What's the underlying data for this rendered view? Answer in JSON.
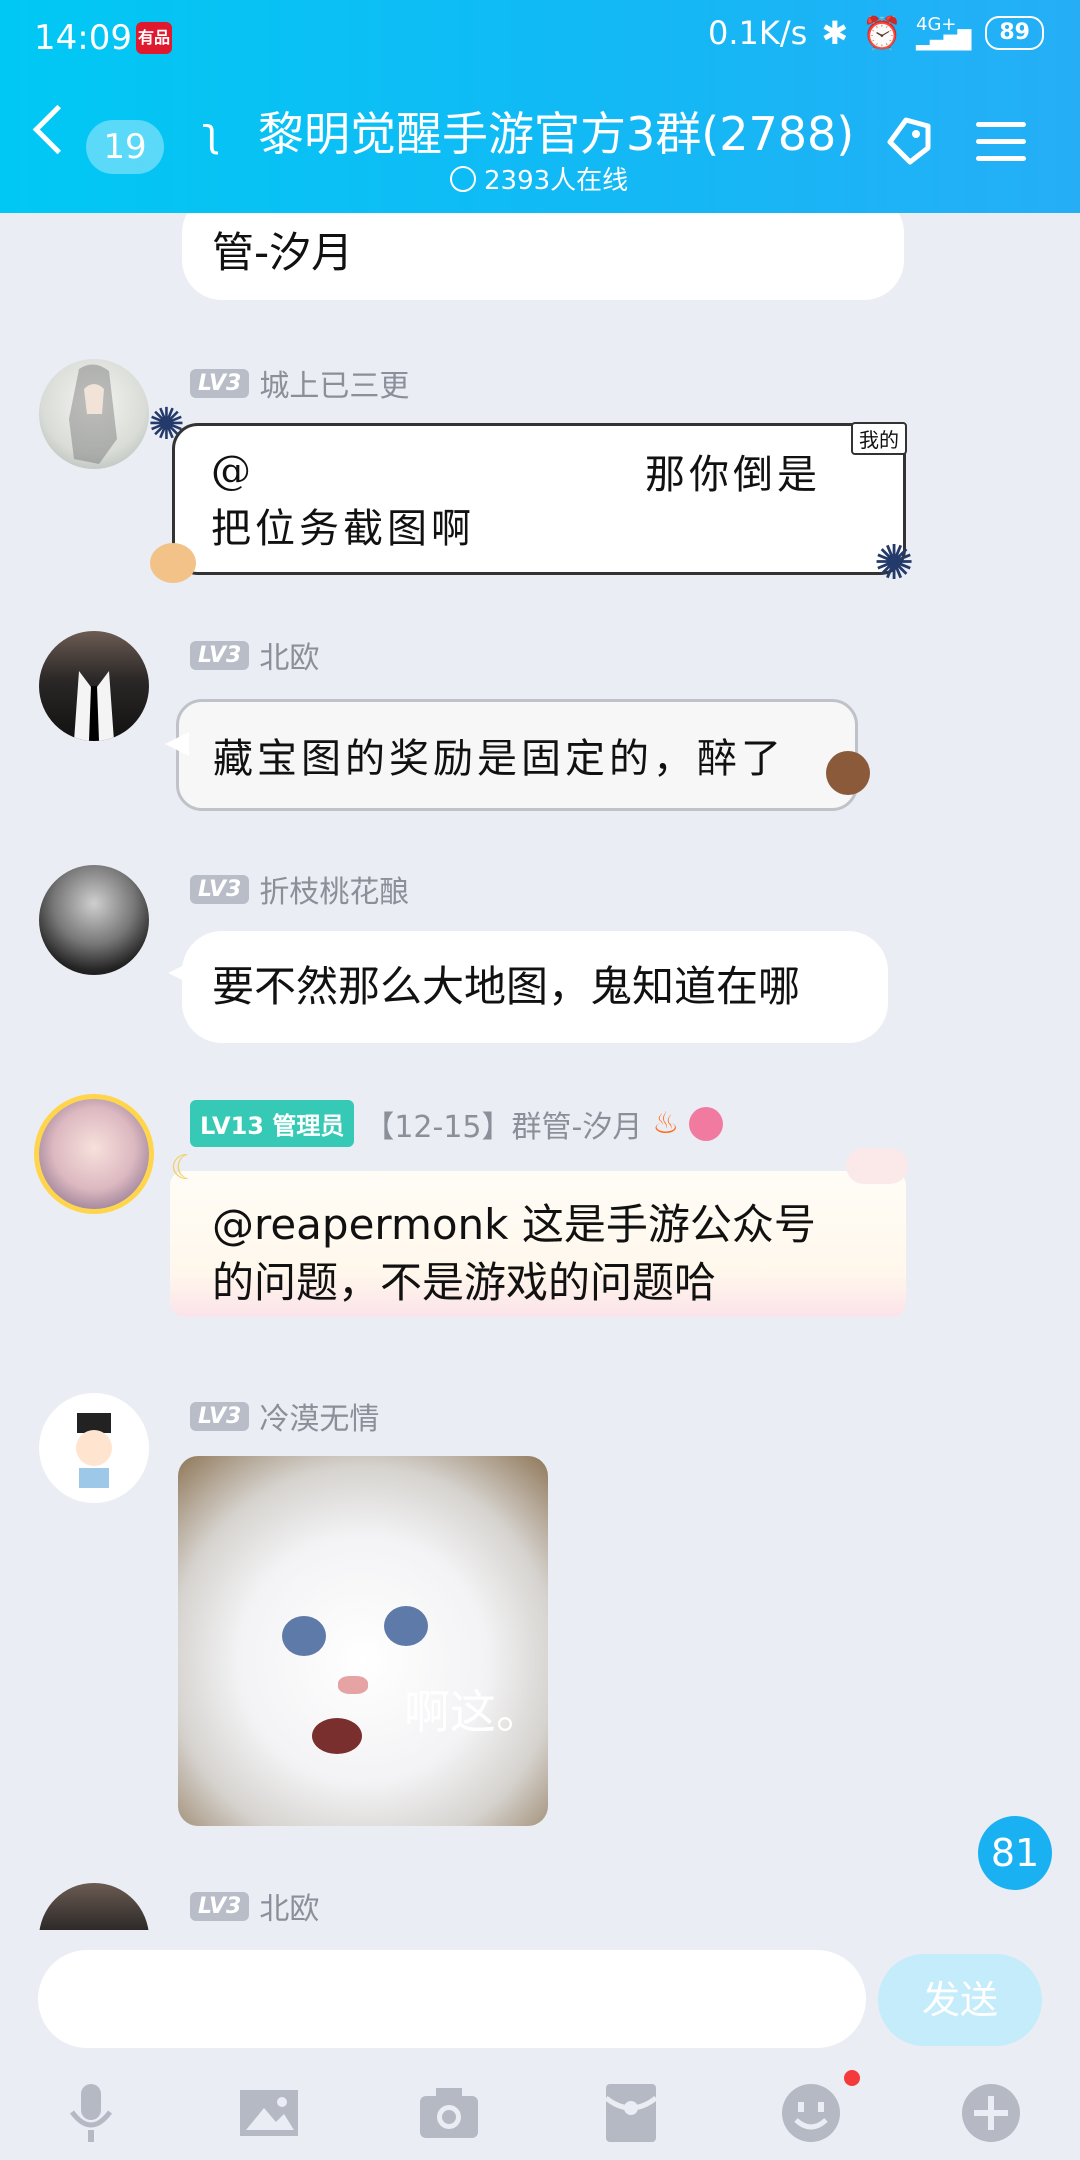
{
  "status_bar": {
    "time": "14:09",
    "badge": "有品",
    "net_speed": "0.1K/s",
    "signal": "4G+",
    "battery": "89"
  },
  "header": {
    "unread_count": "19",
    "title": "黎明觉醒手游官方3群(2788)",
    "online": "2393人在线"
  },
  "messages": [
    {
      "text_partial": "管-汐月"
    },
    {
      "level": "LV3",
      "name": "城上已三更",
      "text_line1": "@",
      "text_line1_right": "那你倒是",
      "text_line2": "把位务截图啊",
      "tag": "我的"
    },
    {
      "level": "LV3",
      "name": "北欧",
      "text": "藏宝图的奖励是固定的，醉了"
    },
    {
      "level": "LV3",
      "name": "折枝桃花酿",
      "text": "要不然那么大地图，鬼知道在哪"
    },
    {
      "level": "LV13",
      "role": "管理员",
      "name": "【12-15】群管-汐月",
      "text_line1": "@reapermonk 这是手游公众号",
      "text_line2": "的问题，不是游戏的问题哈"
    },
    {
      "level": "LV3",
      "name": "冷漠无情",
      "image_caption": "啊这。"
    },
    {
      "level": "LV3",
      "name": "北欧"
    }
  ],
  "new_message_count": "81",
  "input": {
    "placeholder": "",
    "send_label": "发送"
  },
  "toolbar": [
    "mic-icon",
    "image-icon",
    "camera-icon",
    "red-packet-icon",
    "emoji-icon",
    "plus-icon"
  ],
  "colors": {
    "header": "#14b8f5",
    "admin": "#36c9b5",
    "send": "#c4ecfb"
  }
}
